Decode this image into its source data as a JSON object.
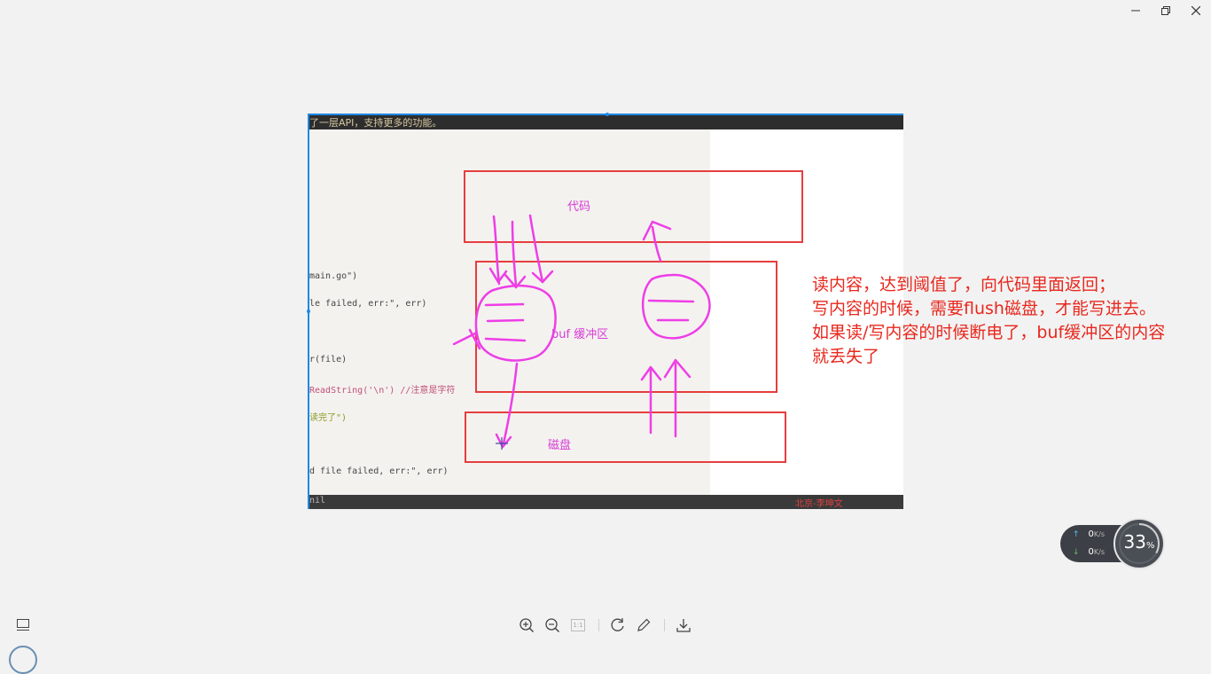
{
  "window": {
    "controls": {
      "minimize": "–",
      "restore": "❐",
      "close": "✕"
    }
  },
  "image": {
    "header_text": "了一层API，支持更多的功能。",
    "code_lines": [
      "main.go\")",
      "le failed, err:\", err)",
      "r(file)",
      "ReadString('\\n') //注意是字符",
      "读完了\")",
      "d file failed, err:\", err)",
      "nil"
    ],
    "footer_text": "北京-李坤文",
    "boxes": {
      "code_label": "代码",
      "buffer_label": "buf  缓冲区",
      "disk_label": "磁盘"
    }
  },
  "annotation": {
    "lines": [
      "读内容，达到阈值了，向代码里面返回；",
      "写内容的时候，需要flush磁盘，才能写进去。",
      "如果读/写内容的时候断电了，buf缓冲区的内容",
      "就丢失了"
    ]
  },
  "network_widget": {
    "upload": "0",
    "download": "0",
    "unit": "K/s",
    "usage_value": "33",
    "usage_unit": "%"
  },
  "toolbar": {
    "icons": [
      "thumbnail-icon",
      "zoom-in-icon",
      "zoom-out-icon",
      "actual-size-icon",
      "rotate-icon",
      "edit-icon",
      "download-icon"
    ],
    "actual_size_label": "1:1"
  },
  "colors": {
    "background": "#f2f2f2",
    "box_border": "#e53e3e",
    "pen": "#ee3ee6",
    "annotation_text": "#e8281e",
    "selection": "#1e88e5"
  }
}
